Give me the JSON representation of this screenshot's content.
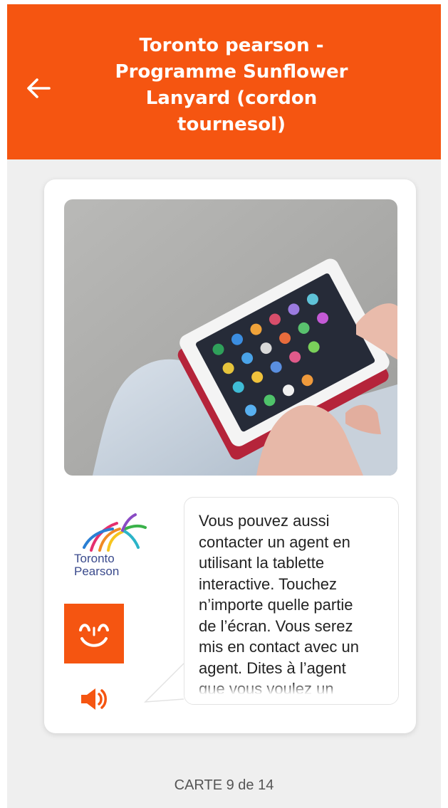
{
  "header": {
    "back_icon": "arrow-left-icon",
    "title_lines": [
      "Toronto pearson -",
      "Programme Sunflower",
      "Lanyard (cordon",
      "tournesol)"
    ],
    "background_color": "#f55511"
  },
  "card": {
    "photo": "tablet-in-hands-photo",
    "logo": {
      "line1": "Toronto",
      "line2": "Pearson"
    },
    "avatar_icon": "smiling-face-icon",
    "speaker_icon": "speaker-icon",
    "message": "Vous pouvez aussi\ncontacter un agent en\nutilisant la tablette\ninteractive. Touchez\nn’importe quelle partie\nde l’écran. Vous serez\nmis en contact avec un\nagent. Dites à l’agent\nque vous voulez un"
  },
  "pager": {
    "text": "CARTE 9 de 14"
  }
}
